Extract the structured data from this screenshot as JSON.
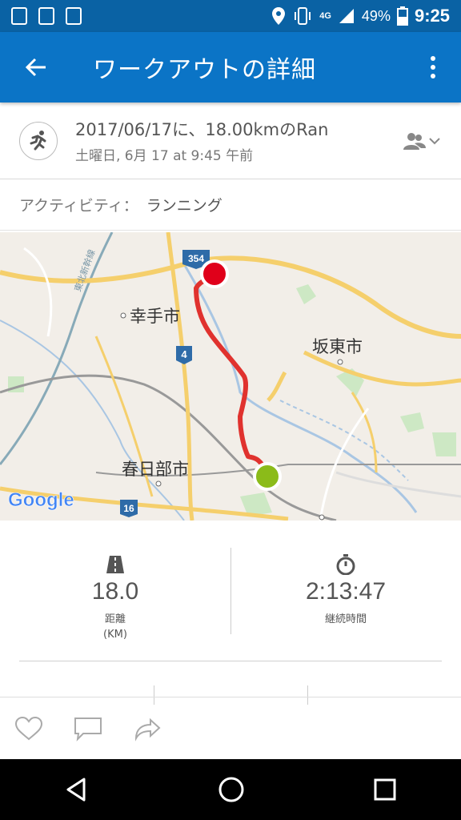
{
  "status": {
    "network": "4G",
    "battery": "49%",
    "time": "9:25"
  },
  "appbar": {
    "title": "ワークアウトの詳細"
  },
  "workout": {
    "title": "2017/06/17に、18.00kmのRan",
    "subtitle": "土曜日, 6月 17 at 9:45 午前"
  },
  "activity": {
    "label": "アクティビティ：",
    "value": "ランニング"
  },
  "map": {
    "labels": [
      "幸手市",
      "坂東市",
      "春日部市",
      "東北新幹線"
    ],
    "road_numbers": [
      "354",
      "4",
      "16"
    ],
    "provider": "Google"
  },
  "stats": {
    "distance": {
      "value": "18.0",
      "label": "距離",
      "unit": "(KM)"
    },
    "duration": {
      "value": "2:13:47",
      "label": "継続時間"
    }
  },
  "icons": {
    "accent": "#0b74c6",
    "route": "#e0322e",
    "start_marker": "#8bbb19",
    "end_marker": "#e0001a"
  }
}
